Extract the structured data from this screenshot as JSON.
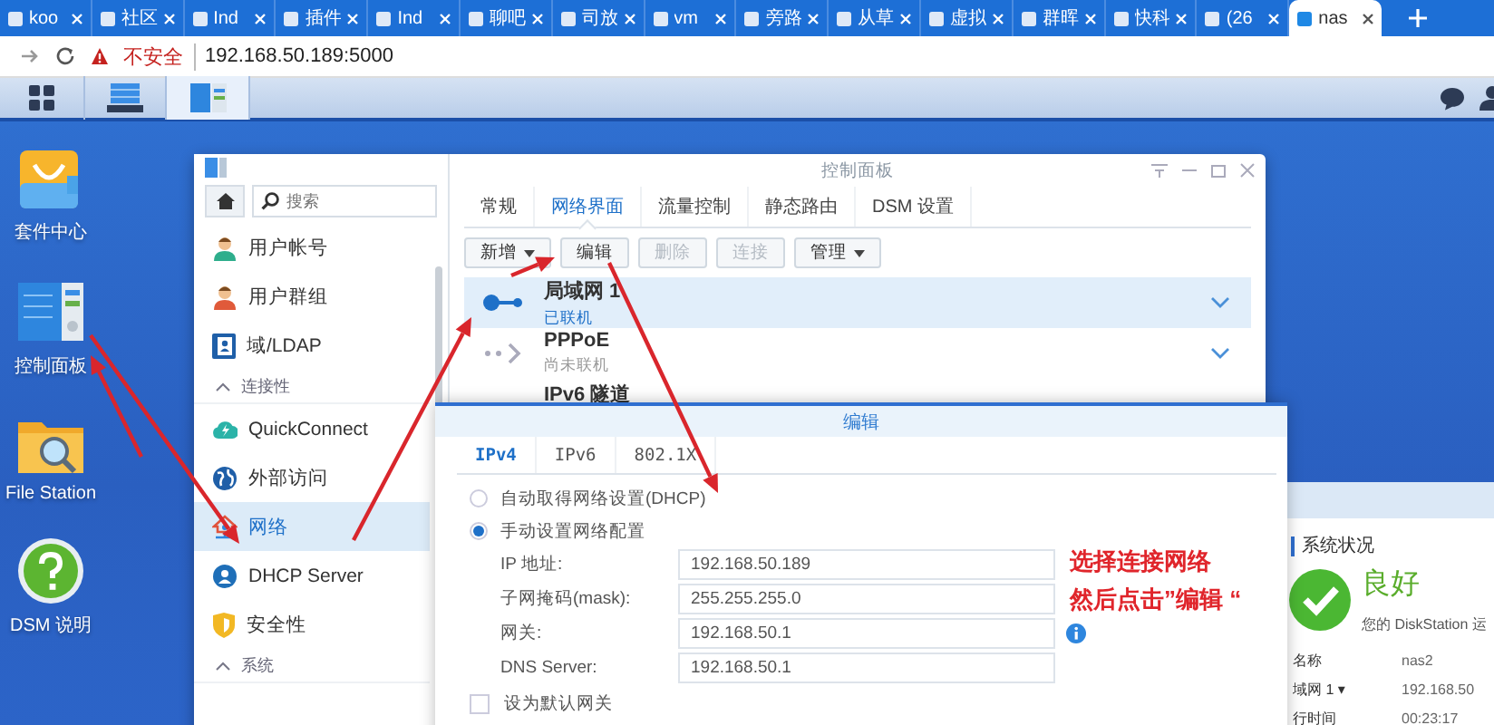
{
  "browser_tabs": [
    {
      "label": "koo",
      "selected": false
    },
    {
      "label": "社区",
      "selected": false
    },
    {
      "label": "Ind",
      "selected": false
    },
    {
      "label": "插件",
      "selected": false
    },
    {
      "label": "Ind",
      "selected": false
    },
    {
      "label": "聊吧",
      "selected": false
    },
    {
      "label": "司放",
      "selected": false
    },
    {
      "label": "vm",
      "selected": false
    },
    {
      "label": "旁路",
      "selected": false
    },
    {
      "label": "从草",
      "selected": false
    },
    {
      "label": "虚拟",
      "selected": false
    },
    {
      "label": "群晖",
      "selected": false
    },
    {
      "label": "快科",
      "selected": false
    },
    {
      "label": "(26",
      "selected": false
    },
    {
      "label": "nas",
      "selected": true
    }
  ],
  "address_bar": {
    "security": "不安全",
    "url": "192.168.50.189:5000"
  },
  "desktop_icons": [
    {
      "kind": "package",
      "label": "套件中心"
    },
    {
      "kind": "panel",
      "label": "控制面板"
    },
    {
      "kind": "folder",
      "label": "File Station"
    },
    {
      "kind": "help",
      "label": "DSM 说明"
    }
  ],
  "control_panel": {
    "title": "控制面板",
    "search": {
      "placeholder": "搜索"
    },
    "sidebar": [
      {
        "kind": "item",
        "label": "用户帐号",
        "selected": false
      },
      {
        "kind": "item",
        "label": "用户群组",
        "selected": false
      },
      {
        "kind": "item",
        "label": "域/LDAP",
        "selected": false
      },
      {
        "kind": "section",
        "label": "连接性",
        "expanded": true
      },
      {
        "kind": "item",
        "label": "QuickConnect",
        "selected": false
      },
      {
        "kind": "item",
        "label": "外部访问",
        "selected": false
      },
      {
        "kind": "item",
        "label": "网络",
        "selected": true
      },
      {
        "kind": "item",
        "label": "DHCP Server",
        "selected": false
      },
      {
        "kind": "item",
        "label": "安全性",
        "selected": false
      },
      {
        "kind": "section",
        "label": "系统",
        "expanded": true
      }
    ],
    "tabs": [
      {
        "label": "常规",
        "selected": false
      },
      {
        "label": "网络界面",
        "selected": true
      },
      {
        "label": "流量控制",
        "selected": false
      },
      {
        "label": "静态路由",
        "selected": false
      },
      {
        "label": "DSM 设置",
        "selected": false
      }
    ],
    "toolbar": [
      {
        "label": "新增",
        "dropdown": true,
        "disabled": false
      },
      {
        "label": "编辑",
        "dropdown": false,
        "disabled": false
      },
      {
        "label": "删除",
        "dropdown": false,
        "disabled": true
      },
      {
        "label": "连接",
        "dropdown": false,
        "disabled": true
      },
      {
        "label": "管理",
        "dropdown": true,
        "disabled": false
      }
    ],
    "interfaces": [
      {
        "name": "局域网 1",
        "status": "已联机",
        "connected": true,
        "selected": true
      },
      {
        "name": "PPPoE",
        "status": "尚未联机",
        "connected": false,
        "selected": false
      },
      {
        "name": "IPv6 隧道",
        "selected": false
      }
    ]
  },
  "edit_dialog": {
    "title": "编辑",
    "tabs": [
      {
        "label": "IPv4",
        "selected": true
      },
      {
        "label": "IPv6",
        "selected": false
      },
      {
        "label": "802.1X",
        "selected": false
      }
    ],
    "modes": [
      {
        "label": "自动取得网络设置(DHCP)",
        "selected": false
      },
      {
        "label": "手动设置网络配置",
        "selected": true
      }
    ],
    "fields": [
      {
        "label": "IP 地址:",
        "value": "192.168.50.189"
      },
      {
        "label": "子网掩码(mask):",
        "value": "255.255.255.0"
      },
      {
        "label": "网关:",
        "value": "192.168.50.1",
        "info": true
      },
      {
        "label": "DNS Server:",
        "value": "192.168.50.1"
      }
    ],
    "options": [
      {
        "label": "设为默认网关",
        "checked": false
      }
    ]
  },
  "annotation": {
    "lines": [
      "选择连接网络",
      "然后点击”编辑 “"
    ]
  },
  "status_widget": {
    "title": "系统状况",
    "status": "良好",
    "message": "您的 DiskStation 运",
    "rows": [
      {
        "label": "名称",
        "value": "nas2"
      },
      {
        "label": "域网 1 ▾",
        "value": "192.168.50"
      },
      {
        "label": "行时间",
        "value": "00:23:17"
      }
    ]
  }
}
